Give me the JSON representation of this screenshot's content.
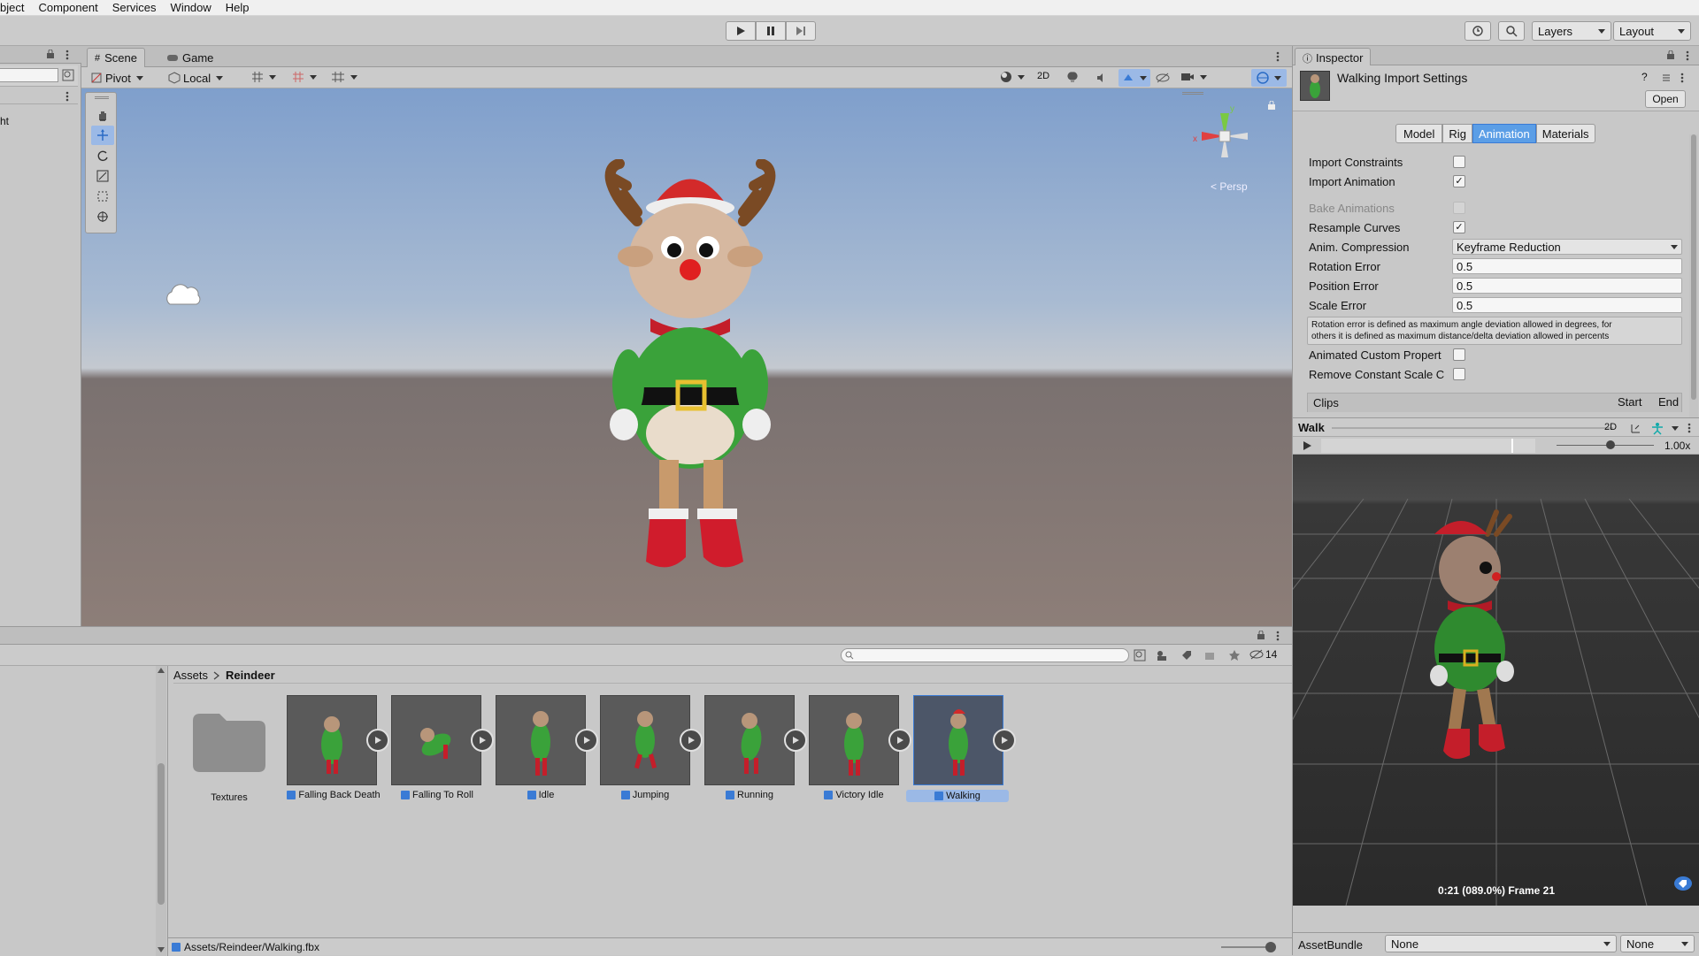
{
  "menubar": {
    "items": [
      "bject",
      "Component",
      "Services",
      "Window",
      "Help"
    ]
  },
  "toolbar": {
    "layers_label": "Layers",
    "layout_label": "Layout"
  },
  "left_panel": {
    "hierarchy_item": "ht"
  },
  "scene_panel": {
    "tabs": [
      "Scene",
      "Game"
    ],
    "pivot_label": "Pivot",
    "local_label": "Local",
    "mode_2d": "2D",
    "persp_label": "< Persp",
    "gizmo_axes": {
      "x": "x",
      "y": "y"
    }
  },
  "inspector": {
    "tab_label": "Inspector",
    "title": "Walking Import Settings",
    "open_label": "Open",
    "tabs": [
      "Model",
      "Rig",
      "Animation",
      "Materials"
    ],
    "active_tab": "Animation",
    "import_constraints": {
      "label": "Import Constraints",
      "checked": false
    },
    "import_animation": {
      "label": "Import Animation",
      "checked": true
    },
    "bake_animations": {
      "label": "Bake Animations",
      "checked": false
    },
    "resample_curves": {
      "label": "Resample Curves",
      "checked": true
    },
    "anim_compression": {
      "label": "Anim. Compression",
      "value": "Keyframe Reduction"
    },
    "rotation_error": {
      "label": "Rotation Error",
      "value": "0.5"
    },
    "position_error": {
      "label": "Position Error",
      "value": "0.5"
    },
    "scale_error": {
      "label": "Scale Error",
      "value": "0.5"
    },
    "help_text_line1": "Rotation error is defined as maximum angle deviation allowed in degrees, for",
    "help_text_line2": "others it is defined as maximum distance/delta deviation allowed in percents",
    "animated_custom": {
      "label": "Animated Custom Propert",
      "checked": false
    },
    "remove_constant_scale": {
      "label": "Remove Constant Scale C",
      "checked": false
    },
    "clips_header": {
      "label": "Clips",
      "start": "Start",
      "end": "End"
    }
  },
  "preview": {
    "clip_name": "Walk",
    "mode_2d": "2D",
    "speed": "1.00x",
    "speed_fraction": 0.55,
    "timeline_fraction": 0.89,
    "status": "0:21 (089.0%) Frame 21"
  },
  "asset_bundle": {
    "label": "AssetBundle",
    "value": "None",
    "variant": "None"
  },
  "project": {
    "breadcrumb_root": "Assets",
    "breadcrumb_current": "Reindeer",
    "hidden_count": "14",
    "folder": {
      "label": "Textures"
    },
    "assets": [
      {
        "label": "Falling Back Death"
      },
      {
        "label": "Falling To Roll"
      },
      {
        "label": "Idle"
      },
      {
        "label": "Jumping"
      },
      {
        "label": "Running"
      },
      {
        "label": "Victory Idle"
      },
      {
        "label": "Walking"
      }
    ],
    "selected_path": "Assets/Reindeer/Walking.fbx"
  },
  "colors": {
    "accent": "#3a7bd5",
    "active_tab": "#5b9ee6",
    "selection": "#9bb9e6"
  }
}
